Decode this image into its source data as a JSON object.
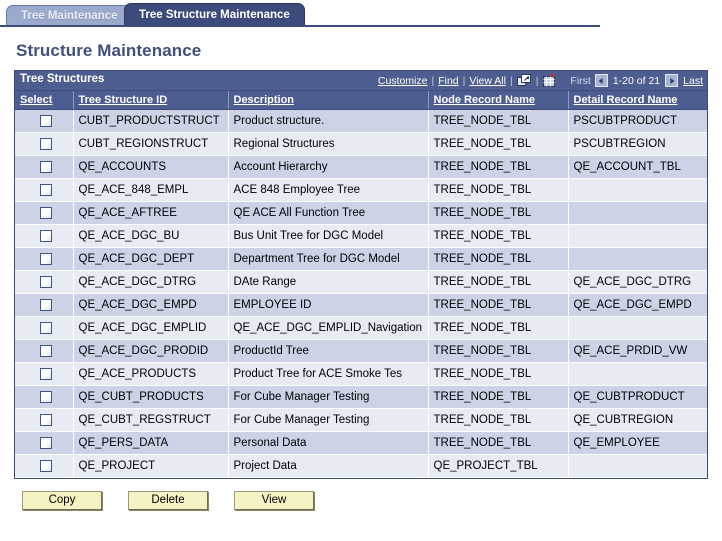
{
  "tabs": [
    {
      "label": "Tree Maintenance",
      "active": false
    },
    {
      "label": "Tree Structure Maintenance",
      "active": true
    }
  ],
  "page_title": "Structure Maintenance",
  "grid": {
    "title": "Tree Structures",
    "tools": {
      "customize": "Customize",
      "find": "Find",
      "view_all": "View All",
      "expand_icon": "expand-window-icon",
      "grid_icon": "download-spreadsheet-icon"
    },
    "pager": {
      "first": "First",
      "prev_icon": "previous-page-arrow-icon",
      "count": "1-20 of 21",
      "next_icon": "next-page-arrow-icon",
      "last": "Last"
    },
    "columns": [
      "Select",
      "Tree Structure ID",
      "Description",
      "Node Record Name",
      "Detail Record Name"
    ],
    "rows": [
      {
        "id": "CUBT_PRODUCTSTRUCT",
        "description": "Product structure.",
        "node_record": "TREE_NODE_TBL",
        "detail_record": "PSCUBTPRODUCT"
      },
      {
        "id": "CUBT_REGIONSTRUCT",
        "description": "Regional Structures",
        "node_record": "TREE_NODE_TBL",
        "detail_record": "PSCUBTREGION"
      },
      {
        "id": "QE_ACCOUNTS",
        "description": "Account Hierarchy",
        "node_record": "TREE_NODE_TBL",
        "detail_record": "QE_ACCOUNT_TBL"
      },
      {
        "id": "QE_ACE_848_EMPL",
        "description": "ACE 848 Employee Tree",
        "node_record": "TREE_NODE_TBL",
        "detail_record": ""
      },
      {
        "id": "QE_ACE_AFTREE",
        "description": "QE ACE All Function Tree",
        "node_record": "TREE_NODE_TBL",
        "detail_record": ""
      },
      {
        "id": "QE_ACE_DGC_BU",
        "description": "Bus Unit Tree for DGC Model",
        "node_record": "TREE_NODE_TBL",
        "detail_record": ""
      },
      {
        "id": "QE_ACE_DGC_DEPT",
        "description": "Department Tree for DGC Model",
        "node_record": "TREE_NODE_TBL",
        "detail_record": ""
      },
      {
        "id": "QE_ACE_DGC_DTRG",
        "description": "DAte Range",
        "node_record": "TREE_NODE_TBL",
        "detail_record": "QE_ACE_DGC_DTRG"
      },
      {
        "id": "QE_ACE_DGC_EMPD",
        "description": "EMPLOYEE ID",
        "node_record": "TREE_NODE_TBL",
        "detail_record": "QE_ACE_DGC_EMPD"
      },
      {
        "id": "QE_ACE_DGC_EMPLID",
        "description": "QE_ACE_DGC_EMPLID_Navigation",
        "node_record": "TREE_NODE_TBL",
        "detail_record": ""
      },
      {
        "id": "QE_ACE_DGC_PRODID",
        "description": "ProductId Tree",
        "node_record": "TREE_NODE_TBL",
        "detail_record": "QE_ACE_PRDID_VW"
      },
      {
        "id": "QE_ACE_PRODUCTS",
        "description": "Product Tree for ACE Smoke Tes",
        "node_record": "TREE_NODE_TBL",
        "detail_record": ""
      },
      {
        "id": "QE_CUBT_PRODUCTS",
        "description": "For Cube Manager Testing",
        "node_record": "TREE_NODE_TBL",
        "detail_record": "QE_CUBTPRODUCT"
      },
      {
        "id": "QE_CUBT_REGSTRUCT",
        "description": "For Cube Manager Testing",
        "node_record": "TREE_NODE_TBL",
        "detail_record": "QE_CUBTREGION"
      },
      {
        "id": "QE_PERS_DATA",
        "description": "Personal Data",
        "node_record": "TREE_NODE_TBL",
        "detail_record": "QE_EMPLOYEE"
      },
      {
        "id": "QE_PROJECT",
        "description": "Project Data",
        "node_record": "QE_PROJECT_TBL",
        "detail_record": ""
      }
    ]
  },
  "buttons": [
    {
      "label": "Copy"
    },
    {
      "label": "Delete"
    },
    {
      "label": "View"
    }
  ],
  "colors": {
    "header_blue": "#4d5d8f",
    "border_blue": "#3c4a7c",
    "tab_active": "#3c4a7c",
    "tab_inactive": "#9aa9cc",
    "row_odd": "#ccd3e6",
    "row_even": "#e7ebf4",
    "title_text": "#40507e",
    "button_face": "#f5f2c4"
  }
}
